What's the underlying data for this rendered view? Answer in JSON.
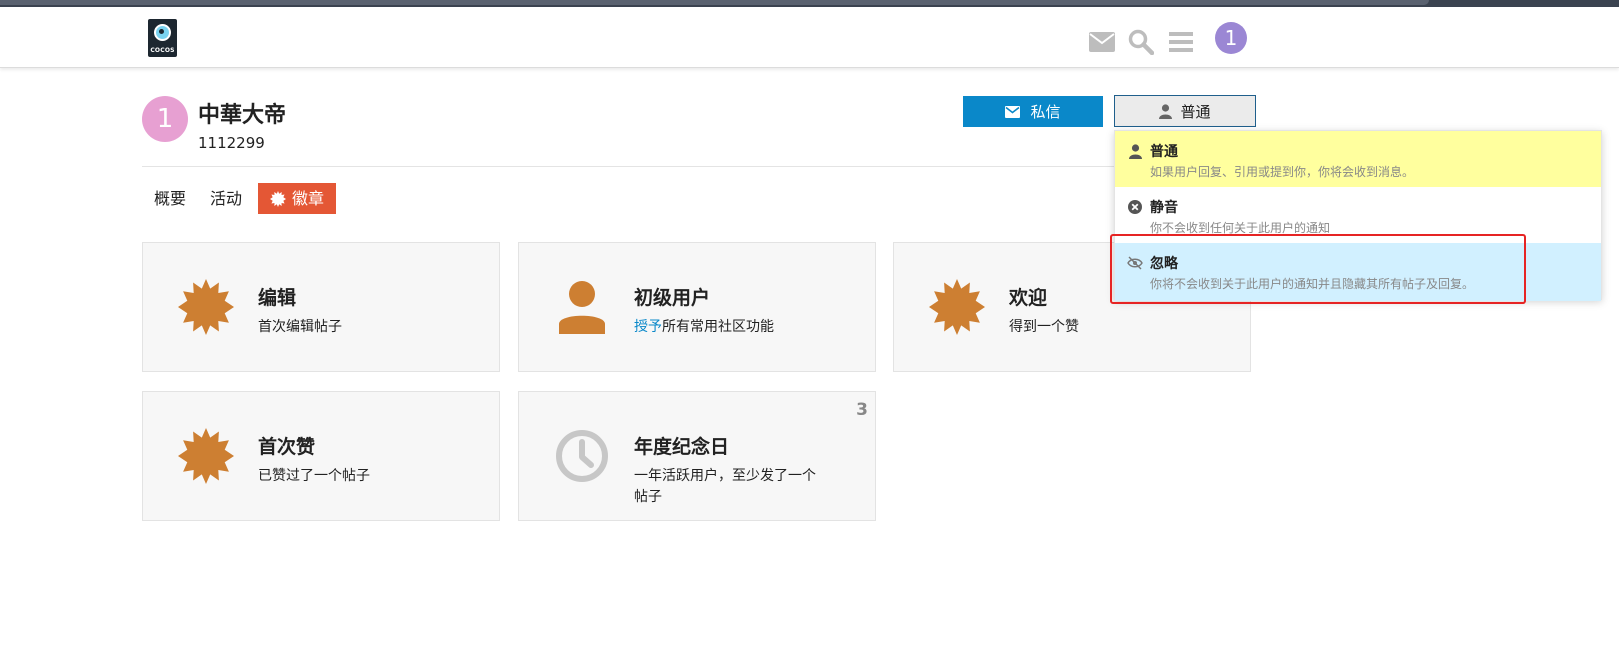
{
  "header": {
    "logo_text": "COCOS",
    "avatar_letter": "1",
    "icons": [
      "envelope-icon",
      "search-icon",
      "hamburger-menu-icon"
    ]
  },
  "profile": {
    "avatar_letter": "1",
    "username": "中華大帝",
    "user_id": "1112299",
    "message_button": "私信",
    "notification_level_button": "普通"
  },
  "tabs": [
    {
      "label": "概要",
      "active": false
    },
    {
      "label": "活动",
      "active": false
    },
    {
      "label": "徽章",
      "active": true
    }
  ],
  "badges": [
    {
      "icon": "badge-burst-icon",
      "title": "编辑",
      "desc": "首次编辑帖子"
    },
    {
      "icon": "user-icon",
      "title": "初级用户",
      "desc_link": "授予",
      "desc": "所有常用社区功能"
    },
    {
      "icon": "badge-burst-icon",
      "title": "欢迎",
      "desc": "得到一个赞"
    },
    {
      "icon": "badge-burst-icon",
      "title": "首次赞",
      "desc": "已赞过了一个帖子"
    },
    {
      "icon": "clock-icon",
      "title": "年度纪念日",
      "desc": "一年活跃用户，至少发了一个帖子",
      "count": "3"
    }
  ],
  "dropdown": {
    "items": [
      {
        "icon": "user-icon",
        "title": "普通",
        "desc": "如果用户回复、引用或提到你，你将会收到消息。",
        "highlight": "#ffff9e"
      },
      {
        "icon": "circle-x-icon",
        "title": "静音",
        "desc": "你不会收到任何关于此用户的通知"
      },
      {
        "icon": "eye-slash-icon",
        "title": "忽略",
        "desc": "你将不会收到关于此用户的通知并且隐藏其所有帖子及回复。",
        "highlight": "#d1f0ff"
      }
    ]
  },
  "colors": {
    "accent_blue": "#0a88c9",
    "badge_orange": "#cd7f32",
    "active_tab": "#e45735",
    "annotation_red": "#e62424"
  }
}
